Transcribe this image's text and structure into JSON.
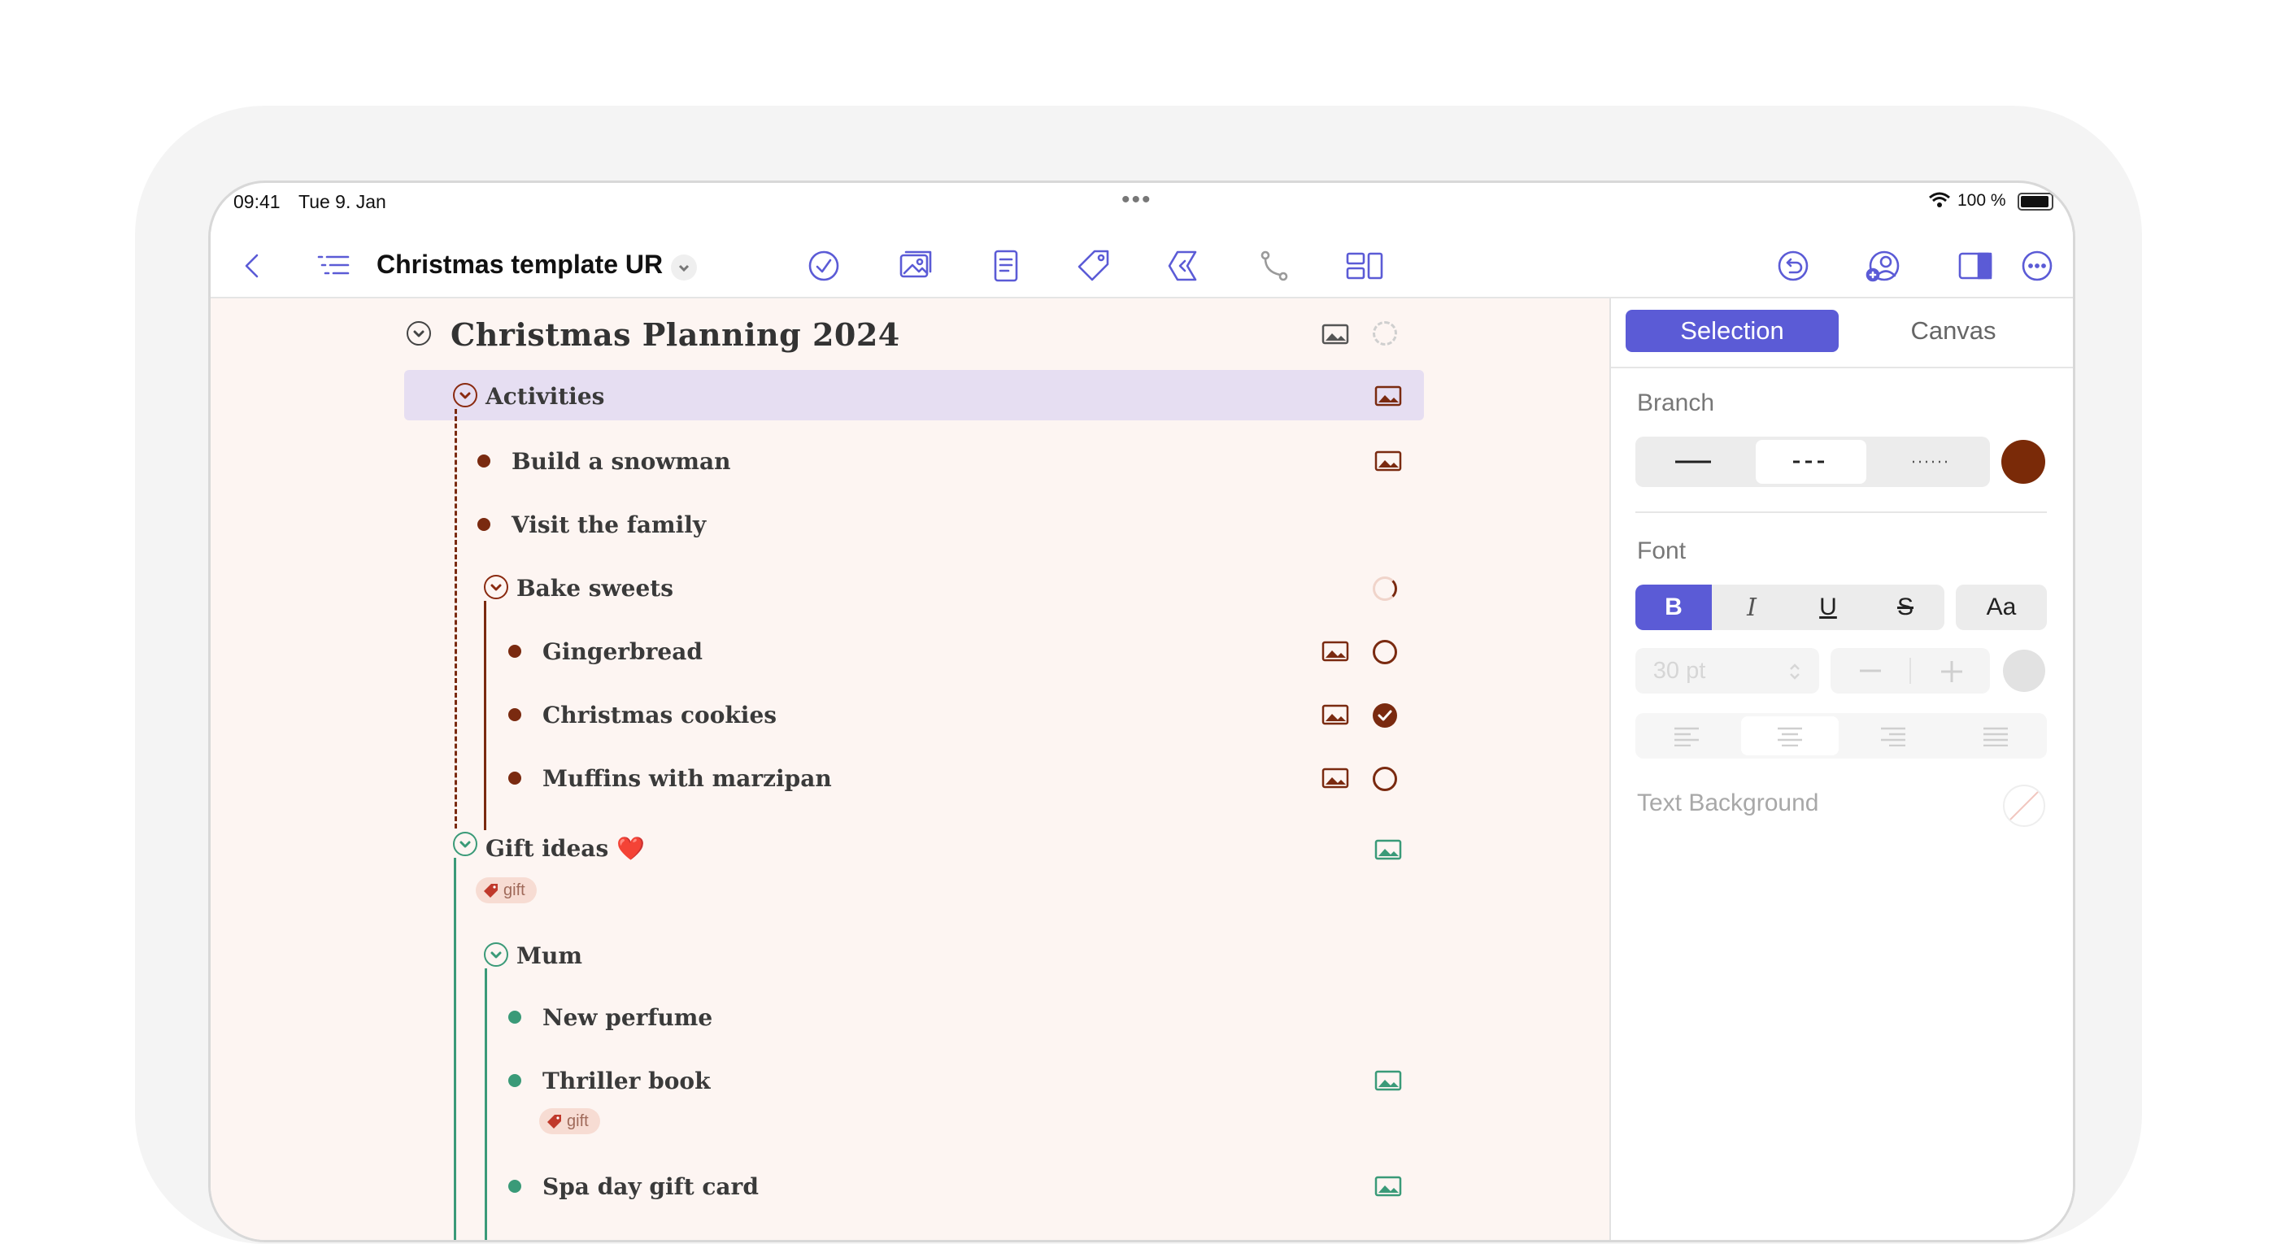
{
  "status_bar": {
    "time": "09:41",
    "date": "Tue 9. Jan",
    "battery": "100 %"
  },
  "toolbar": {
    "doc_title": "Christmas template UR",
    "accent": "#5b5bd6"
  },
  "outline": {
    "root": {
      "title": "Christmas Planning 2024"
    },
    "activities": {
      "title": "Activities",
      "color": "#7a2a10",
      "items": [
        {
          "title": "Build a snowman"
        },
        {
          "title": "Visit the family"
        }
      ],
      "bake": {
        "title": "Bake sweets",
        "items": [
          {
            "title": "Gingerbread",
            "done": false
          },
          {
            "title": "Christmas cookies",
            "done": true
          },
          {
            "title": "Muffins with marzipan",
            "done": false
          }
        ]
      }
    },
    "gifts": {
      "title": "Gift ideas ❤️",
      "color": "#3a9a78",
      "tag": "gift",
      "mum": {
        "title": "Mum",
        "items": [
          {
            "title": "New perfume"
          },
          {
            "title": "Thriller book",
            "tag": "gift"
          },
          {
            "title": "Spa day gift card"
          }
        ]
      }
    }
  },
  "inspector": {
    "tabs": [
      "Selection",
      "Canvas"
    ],
    "branch_label": "Branch",
    "branch_color": "#7a2a08",
    "font_label": "Font",
    "font_styles": [
      "B",
      "I",
      "U",
      "S"
    ],
    "font_case": "Aa",
    "font_size": "30 pt",
    "text_background_label": "Text Background"
  }
}
